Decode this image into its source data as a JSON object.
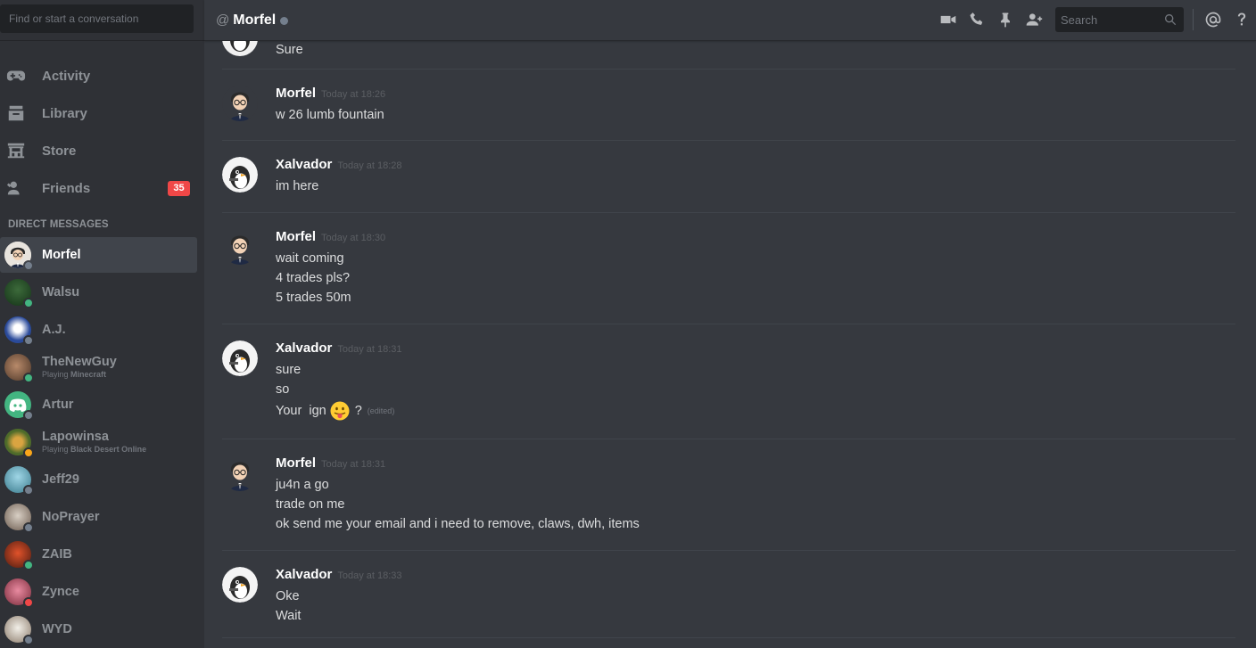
{
  "sidebar": {
    "search_placeholder": "Find or start a conversation",
    "nav": [
      {
        "label": "Activity",
        "icon": "gamepad-icon"
      },
      {
        "label": "Library",
        "icon": "library-icon"
      },
      {
        "label": "Store",
        "icon": "store-icon"
      },
      {
        "label": "Friends",
        "icon": "friends-icon",
        "badge": "35"
      }
    ],
    "dm_header": "DIRECT MESSAGES",
    "dms": [
      {
        "name": "Morfel",
        "status": "offline",
        "active": true
      },
      {
        "name": "Walsu",
        "status": "online"
      },
      {
        "name": "A.J.",
        "status": "offline"
      },
      {
        "name": "TheNewGuy",
        "status": "online",
        "activity_prefix": "Playing",
        "activity_game": "Minecraft"
      },
      {
        "name": "Artur",
        "status": "offline"
      },
      {
        "name": "Lapowinsa",
        "status": "idle",
        "activity_prefix": "Playing",
        "activity_game": "Black Desert Online"
      },
      {
        "name": "Jeff29",
        "status": "offline"
      },
      {
        "name": "NoPrayer",
        "status": "offline"
      },
      {
        "name": "ZAIB",
        "status": "online"
      },
      {
        "name": "Zynce",
        "status": "dnd"
      },
      {
        "name": "WYD",
        "status": "offline"
      }
    ]
  },
  "topbar": {
    "at": "@",
    "title": "Morfel",
    "search_placeholder": "Search",
    "icons": [
      "video-call-icon",
      "voice-call-icon",
      "pin-icon",
      "add-friend-icon",
      "mention-icon",
      "help-icon"
    ]
  },
  "messages": [
    {
      "partial": true,
      "lines": [
        "Sure"
      ]
    },
    {
      "author": "Morfel",
      "time": "Today at 18:26",
      "lines": [
        "w 26 lumb fountain"
      ]
    },
    {
      "author": "Xalvador",
      "time": "Today at 18:28",
      "lines": [
        "im here"
      ]
    },
    {
      "author": "Morfel",
      "time": "Today at 18:30",
      "lines": [
        "wait coming",
        "4 trades pls?",
        "5 trades 50m"
      ]
    },
    {
      "author": "Xalvador",
      "time": "Today at 18:31",
      "lines": [
        "sure",
        "so",
        "Your  ign"
      ],
      "emoji_line_suffix": "?",
      "edited": "(edited)"
    },
    {
      "author": "Morfel",
      "time": "Today at 18:31",
      "lines": [
        "ju4n a go",
        "trade on me",
        "ok send me your email and i need to remove, claws, dwh, items"
      ]
    },
    {
      "author": "Xalvador",
      "time": "Today at 18:33",
      "lines": [
        "Oke",
        "Wait"
      ]
    }
  ],
  "colors": {
    "online": "#43b581",
    "idle": "#faa61a",
    "dnd": "#f04747",
    "offline": "#747f8d",
    "badge": "#f04747"
  }
}
